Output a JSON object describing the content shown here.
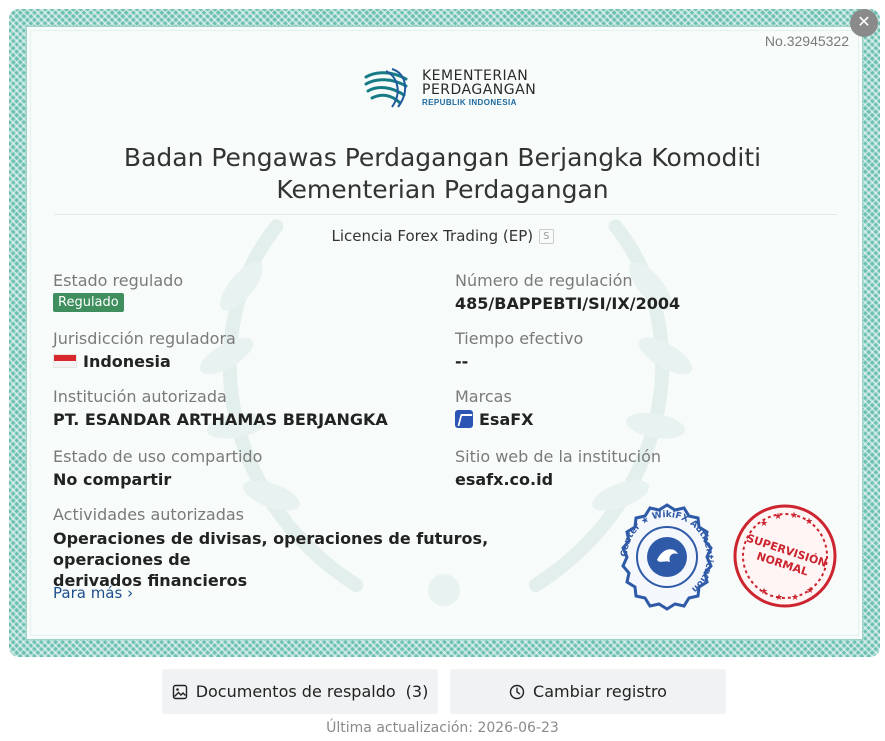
{
  "certificate": {
    "number": "No.32945322",
    "logo": {
      "line1": "KEMENTERIAN",
      "line2": "PERDAGANGAN",
      "line3": "REPUBLIK INDONESIA"
    },
    "title_line1": "Badan Pengawas Perdagangan Berjangka Komoditi",
    "title_line2": "Kementerian Perdagangan",
    "license_type": "Licencia Forex Trading (EP)",
    "license_badge": "S"
  },
  "fields": {
    "regulated_status": {
      "label": "Estado regulado",
      "value": "Regulado"
    },
    "regulation_number": {
      "label": "Número de regulación",
      "value": "485/BAPPEBTI/SI/IX/2004"
    },
    "jurisdiction": {
      "label": "Jurisdicción reguladora",
      "value": "Indonesia"
    },
    "effective_time": {
      "label": "Tiempo efectivo",
      "value": "--"
    },
    "institution": {
      "label": "Institución autorizada",
      "value": "PT. ESANDAR ARTHAMAS BERJANGKA"
    },
    "brands": {
      "label": "Marcas",
      "value": "EsaFX"
    },
    "shared_status": {
      "label": "Estado de uso compartido",
      "value": "No compartir"
    },
    "website": {
      "label": "Sitio web de la institución",
      "value": "esafx.co.id"
    },
    "activities": {
      "label": "Actividades autorizadas",
      "value_line1": "Operaciones de divisas, operaciones de futuros, operaciones de",
      "value_line2": "derivados financieros"
    }
  },
  "more_link": "Para más",
  "seals": {
    "wikifx_ring_text": "Center ★ WikiFX Authentication",
    "supervision_line1": "SUPERVISIÓN",
    "supervision_line2": "NORMAL"
  },
  "actions": {
    "documents_label": "Documentos de respaldo",
    "documents_count": "(3)",
    "change_label": "Cambiar registro"
  },
  "updated": "Última actualización: 2026-06-23",
  "colors": {
    "frame": "#6cc0b2",
    "regulated_tag": "#3e8e5e",
    "link": "#1d4f8c",
    "seal_blue": "#2f5aa8",
    "seal_red": "#cc2530",
    "logo_teal": "#177b86"
  },
  "icons": {
    "close": "close-icon",
    "flag": "indonesia-flag-icon",
    "brand": "esafx-brand-icon",
    "more": "chevron-right-icon",
    "documents": "image-icon",
    "change": "clock-icon"
  }
}
